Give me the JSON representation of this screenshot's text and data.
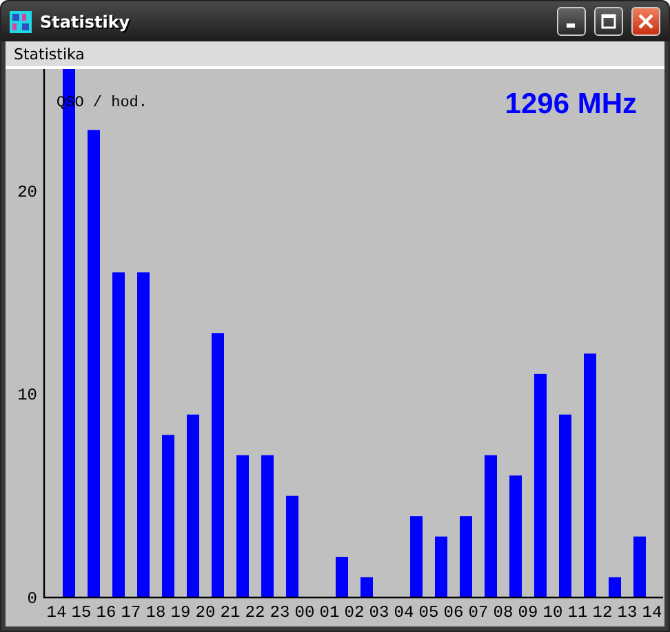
{
  "window": {
    "title": "Statistiky"
  },
  "menu": [
    {
      "label": "Statistika"
    }
  ],
  "chart": {
    "chart_data": {
      "type": "bar",
      "title": "1296 MHz",
      "ylabel": "QSO / hod.",
      "ylim": [
        0,
        26
      ],
      "yticks": [
        0,
        10,
        20
      ],
      "categories": [
        "14",
        "15",
        "16",
        "17",
        "18",
        "19",
        "20",
        "21",
        "22",
        "23",
        "00",
        "01",
        "02",
        "03",
        "04",
        "05",
        "06",
        "07",
        "08",
        "09",
        "10",
        "11",
        "12",
        "13",
        "14"
      ],
      "series": [
        {
          "color": "#0000ff",
          "values": [
            26,
            23,
            16,
            16,
            8,
            9,
            13,
            7,
            7,
            5,
            0,
            2,
            1,
            0,
            4,
            3,
            4,
            7,
            6,
            11,
            9,
            12,
            1,
            3,
            null
          ]
        }
      ]
    }
  }
}
